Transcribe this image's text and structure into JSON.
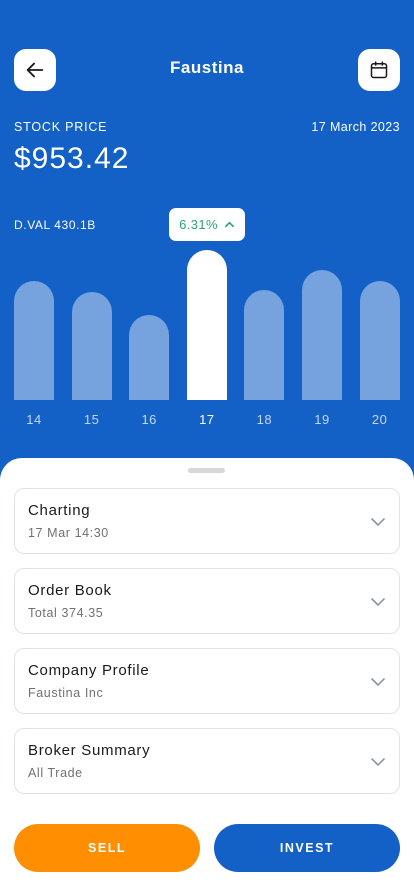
{
  "header": {
    "title": "Faustina",
    "stock_label": "STOCK PRICE",
    "date": "17 March 2023",
    "price": "$953.42",
    "dval": "D.VAL 430.1B",
    "change": "6.31%"
  },
  "colors": {
    "primary": "#1360C6",
    "accent": "#FF8F00",
    "positive": "#2AA56A"
  },
  "chart_data": {
    "type": "bar",
    "categories": [
      "14",
      "15",
      "16",
      "17",
      "18",
      "19",
      "20"
    ],
    "values": [
      119,
      108,
      85,
      150,
      110,
      130,
      119
    ],
    "active_index": 3,
    "ylim": [
      0,
      150
    ]
  },
  "cards": [
    {
      "title": "Charting",
      "subtitle": "17 Mar 14:30"
    },
    {
      "title": "Order Book",
      "subtitle": "Total 374.35"
    },
    {
      "title": "Company Profile",
      "subtitle": "Faustina Inc"
    },
    {
      "title": "Broker Summary",
      "subtitle": "All Trade"
    }
  ],
  "actions": {
    "sell_label": "SELL",
    "invest_label": "INVEST"
  }
}
